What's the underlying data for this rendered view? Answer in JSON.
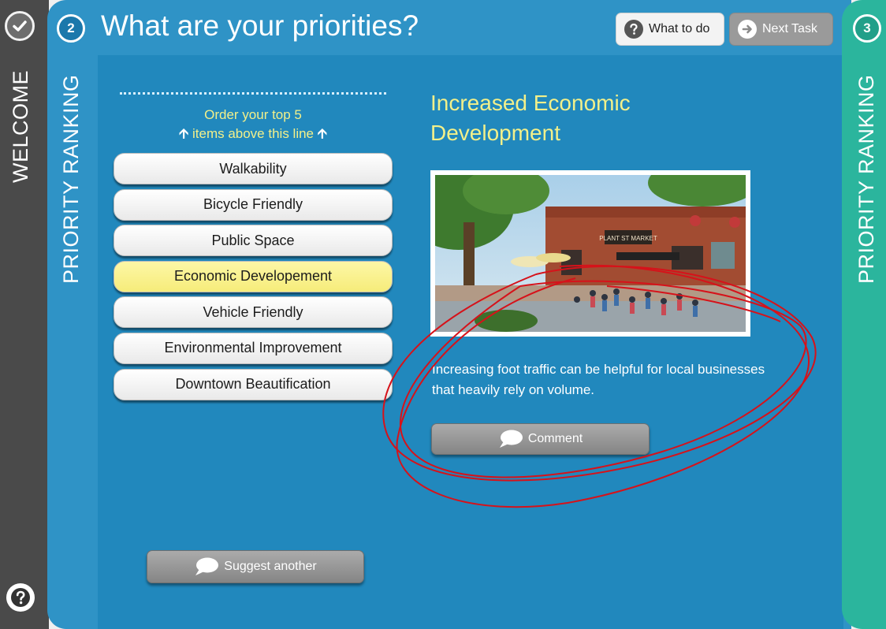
{
  "left_rail": {
    "label": "WELCOME",
    "check_icon": "check-icon",
    "help_icon": "question-icon"
  },
  "header": {
    "step_number": "2",
    "title": "What are your priorities?",
    "side_label": "PRIORITY RANKING",
    "what_to_do": {
      "label": "What to do",
      "icon": "question-circle-icon"
    },
    "next_task": {
      "label": "Next Task",
      "icon": "arrow-right-circle-icon"
    }
  },
  "right_rail": {
    "step_number": "3",
    "label": "PRIORITY RANKING"
  },
  "ranking": {
    "hint_line1": "Order your top 5",
    "hint_line2": "items above this line",
    "items": [
      {
        "label": "Walkability"
      },
      {
        "label": "Bicycle Friendly"
      },
      {
        "label": "Public Space"
      },
      {
        "label": "Economic Developement"
      },
      {
        "label": "Vehicle Friendly"
      },
      {
        "label": "Environmental Improvement"
      },
      {
        "label": "Downtown Beautification"
      }
    ],
    "selected_index": 3
  },
  "suggest": {
    "label": "Suggest another"
  },
  "detail": {
    "title": "Increased Economic Development",
    "description": "Increasing foot traffic can be helpful for local businesses that heavily rely on volume.",
    "comment_label": "Comment",
    "image_sign": "PLANT ST MARKET"
  },
  "colors": {
    "main_blue": "#2f93c6",
    "stage_blue": "#2188bd",
    "left_rail": "#4a4a4a",
    "right_rail": "#2bb59d",
    "accent_yellow": "#f2f08a",
    "selected_item": "#f6ec7a",
    "annotation_red": "#d6121a"
  }
}
